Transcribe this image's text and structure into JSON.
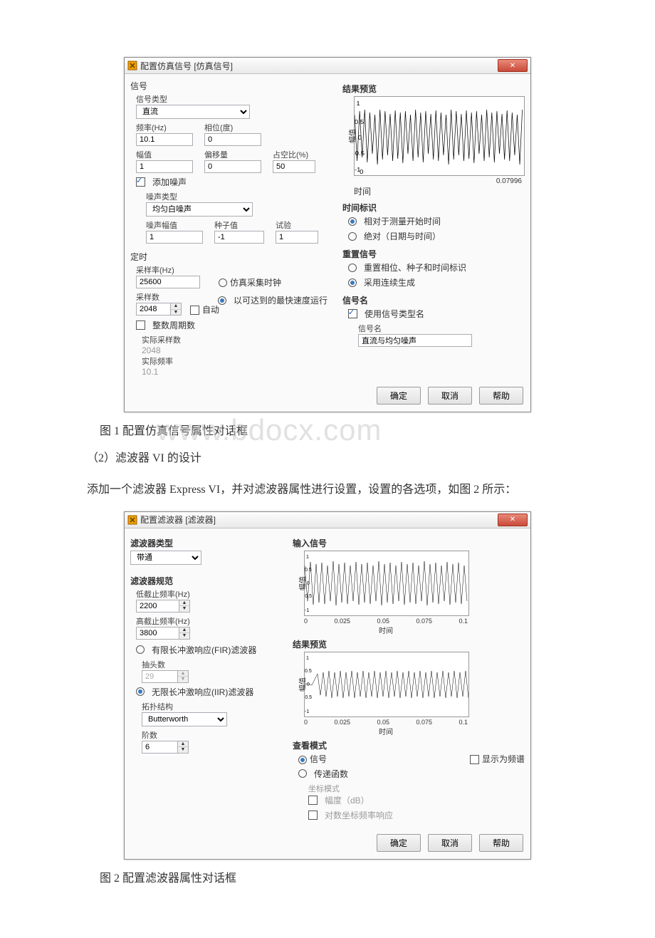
{
  "watermark": "www.bdocx.com",
  "dialog1": {
    "title": "配置仿真信号 [仿真信号]",
    "signal": {
      "section": "信号",
      "type_label": "信号类型",
      "type_value": "直流",
      "freq_label": "频率(Hz)",
      "freq_value": "10.1",
      "phase_label": "相位(度)",
      "phase_value": "0",
      "amp_label": "幅值",
      "amp_value": "1",
      "offset_label": "偏移量",
      "offset_value": "0",
      "duty_label": "占空比(%)",
      "duty_value": "50",
      "add_noise_label": "添加噪声",
      "noise_type_label": "噪声类型",
      "noise_type_value": "均匀白噪声",
      "noise_amp_label": "噪声幅值",
      "noise_amp_value": "1",
      "seed_label": "种子值",
      "seed_value": "-1",
      "trial_label": "试验",
      "trial_value": "1"
    },
    "timing": {
      "section": "定时",
      "rate_label": "采样率(Hz)",
      "rate_value": "25600",
      "samples_label": "采样数",
      "samples_value": "2048",
      "auto_label": "自动",
      "sim_clock_label": "仿真采集时钟",
      "fastest_label": "以可达到的最快速度运行",
      "int_cycles_label": "整数周期数",
      "actual_samples_label": "实际采样数",
      "actual_samples_value": "2048",
      "actual_freq_label": "实际频率",
      "actual_freq_value": "10.1"
    },
    "preview": {
      "section": "结果预览",
      "ylabel": "幅值",
      "xlabel": "时间",
      "xmax": "0.07996"
    },
    "timestamp": {
      "section": "时间标识",
      "relative_label": "相对于测量开始时间",
      "absolute_label": "绝对（日期与时间）"
    },
    "reset": {
      "section": "重置信号",
      "reset_phase_label": "重置相位、种子和时间标识",
      "continuous_label": "采用连续生成"
    },
    "signame": {
      "section": "信号名",
      "use_type_label": "使用信号类型名",
      "name_label": "信号名",
      "name_value": "直流与均匀噪声"
    },
    "buttons": {
      "ok": "确定",
      "cancel": "取消",
      "help": "帮助"
    }
  },
  "caption1": "图 1 配置仿真信号属性对话框",
  "para1": "（2）滤波器 VI 的设计",
  "para2": "添加一个滤波器 Express VI，并对滤波器属性进行设置，设置的各选项，如图 2 所示：",
  "dialog2": {
    "title": "配置滤波器 [滤波器]",
    "filter": {
      "type_section": "滤波器类型",
      "type_value": "带通",
      "spec_section": "滤波器规范",
      "low_cut_label": "低截止频率(Hz)",
      "low_cut_value": "2200",
      "high_cut_label": "高截止频率(Hz)",
      "high_cut_value": "3800",
      "fir_label": "有限长冲激响应(FIR)滤波器",
      "taps_label": "抽头数",
      "taps_value": "29",
      "iir_label": "无限长冲激响应(IIR)滤波器",
      "topology_label": "拓扑结构",
      "topology_value": "Butterworth",
      "order_label": "阶数",
      "order_value": "6"
    },
    "input_section": "输入信号",
    "preview_section": "结果预览",
    "plot": {
      "ylabel": "幅值",
      "xlabel": "时间",
      "ticks": [
        "0",
        "0.025",
        "0.05",
        "0.075",
        "0.1"
      ]
    },
    "view": {
      "section": "查看模式",
      "signal_label": "信号",
      "show_spectrum_label": "显示为频谱",
      "transfer_label": "传递函数",
      "coord_section": "坐标模式",
      "mag_label": "幅度（dB）",
      "log_label": "对数坐标频率响应"
    },
    "buttons": {
      "ok": "确定",
      "cancel": "取消",
      "help": "帮助"
    }
  },
  "caption2": "图 2 配置滤波器属性对话框"
}
